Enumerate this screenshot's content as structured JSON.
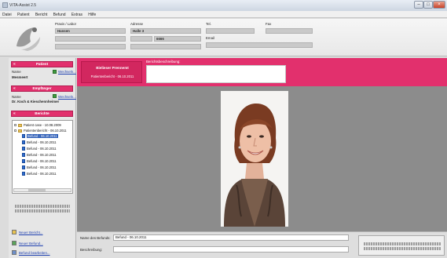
{
  "window": {
    "title": "VITA-Assist 2.5",
    "buttons": [
      "–",
      "□",
      "×"
    ]
  },
  "menu": [
    "Datei",
    "Patient",
    "Bericht",
    "Befund",
    "Extras",
    "Hilfe"
  ],
  "header": {
    "praxis_label": "Praxis / Labor",
    "praxis_value": "Hansen",
    "adresse_label": "Adresse",
    "adresse_value": "Halle 3",
    "adresse_city": "6666",
    "tel_label": "Tel.",
    "email_label": "Email",
    "fax_label": "Fax"
  },
  "left": {
    "patient": {
      "heading": "Patient",
      "name_label": "Name",
      "name_value": "Mesmeert",
      "link": "Wechseln..."
    },
    "empfaenger": {
      "heading": "Empfänger",
      "name_label": "Name",
      "name_value": "Dr. Koch & Kieschennheimer",
      "link": "Wechseln..."
    },
    "berichte": {
      "heading": "Berichte",
      "tree": [
        {
          "text": "Patient case - 10.08.2009",
          "type": "folder",
          "level": 0
        },
        {
          "text": "Patientenbericht - 06.10.2011",
          "type": "folder",
          "level": 0
        },
        {
          "text": "Befund - 06.10.2011",
          "type": "doc",
          "level": 1,
          "selected": true
        },
        {
          "text": "Befund - 06.10.2011",
          "type": "doc",
          "level": 1
        },
        {
          "text": "Befund - 06.10.2011",
          "type": "doc",
          "level": 1
        },
        {
          "text": "Befund - 06.10.2011",
          "type": "doc",
          "level": 1
        },
        {
          "text": "Befund - 06.10.2011",
          "type": "doc",
          "level": 1
        },
        {
          "text": "Befund - 06.10.2011",
          "type": "doc",
          "level": 1
        },
        {
          "text": "Befund - 06.10.2011",
          "type": "doc",
          "level": 1
        }
      ]
    },
    "actions": [
      "Neuer Bericht...",
      "Neuer Befund...",
      "Befund bearbeiten..."
    ]
  },
  "main": {
    "patient_name": "Bielieser Prennemt",
    "patient_report": "Patientenbericht - 06.10.2011",
    "desc_label": "Berichtsbeschreibung:",
    "befund_name_label": "Name des Befunds:",
    "befund_name_value": "Befund - 06.10.2011",
    "beschreibung_label": "Beschreibung:"
  },
  "colors": {
    "accent": "#e2306d",
    "viewer_bg": "#8c8c8c"
  }
}
